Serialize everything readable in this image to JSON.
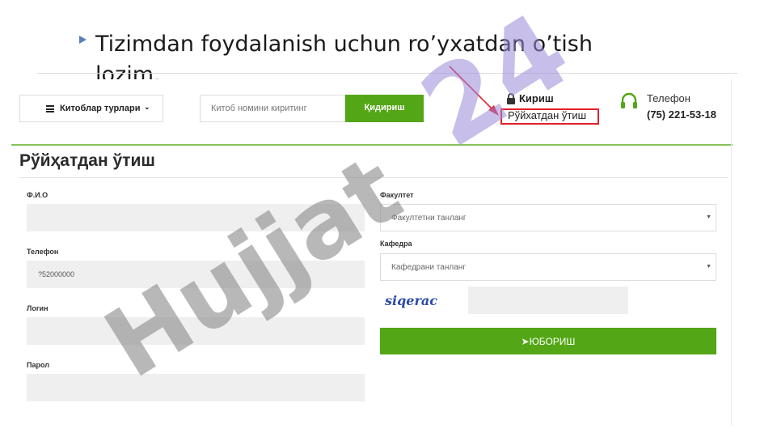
{
  "slide": {
    "bullet_text": "Tizimdan foydalanish uchun ro’yxatdan o’tish lozim."
  },
  "header": {
    "menu_label": "Китоблар турлари",
    "search_placeholder": "Китоб номини киритинг",
    "search_button": "Қидириш",
    "login_label": "Кириш",
    "register_label": "Рўйхатдан ўтиш",
    "phone_label": "Телефон",
    "phone_number": "(75) 221-53-18"
  },
  "page": {
    "title": "Рўйҳатдан ўтиш"
  },
  "form": {
    "fio_label": "Ф.И.О",
    "fio_value": "",
    "phone_label": "Телефон",
    "phone_value": "?52000000",
    "login_label": "Логин",
    "login_value": "",
    "password_label": "Парол",
    "password_value": "",
    "faculty_label": "Факултет",
    "faculty_selected": "Факултетни танланг",
    "department_label": "Кафедра",
    "department_selected": "Кафедрани танланг",
    "captcha_text": "siqerac",
    "submit_label": "ЮБОРИШ"
  },
  "watermark": {
    "text": "Hujjat 24"
  },
  "colors": {
    "accent_green": "#53a615",
    "highlight_red": "#e0202a",
    "watermark_gray": "#8a8a8a",
    "watermark_purple": "#9a8ad8"
  }
}
